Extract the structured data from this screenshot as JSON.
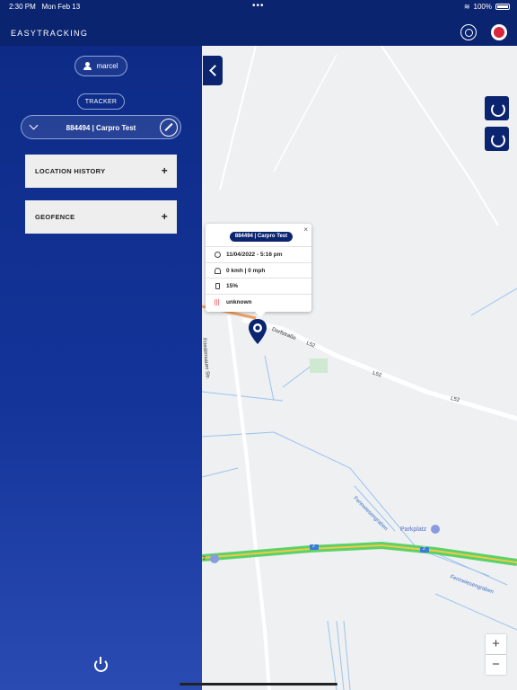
{
  "status_bar": {
    "time": "2:30 PM",
    "date": "Mon Feb 13",
    "dots": "•••",
    "wifi_icon": "wifi-icon",
    "battery_pct": "100%"
  },
  "header": {
    "brand": "EASYTRACKING",
    "icons": [
      "target-icon",
      "alert-pin-icon"
    ]
  },
  "sidebar": {
    "user": "marcel",
    "tracker_label": "TRACKER",
    "tracker_selected": "884494 | Carpro Test",
    "menu": [
      {
        "label": "LOCATION HISTORY",
        "action": "+"
      },
      {
        "label": "GEOFENCE",
        "action": "+"
      }
    ]
  },
  "popup": {
    "title": "884494 | Carpro Test",
    "close": "×",
    "datetime": "11/04/2022 - 5:16 pm",
    "speed": "0 kmh | 0 mph",
    "battery": "15%",
    "signal": "unknown"
  },
  "map": {
    "labels": {
      "dorfstrasse": "Dorfstraße",
      "l52_a": "L52",
      "l52_b": "L52",
      "l52_c": "L52",
      "friedensauer": "Friedensauer Str.",
      "fennwiesengraben_1": "Fennwiesengraben",
      "fennwiesengraben_2": "Fennwiesengraben",
      "parkplatz": "Parkplatz",
      "route_2a": "2",
      "route_2b": "2",
      "route_2c": "2"
    },
    "zoom_in": "+",
    "zoom_out": "−",
    "colors": {
      "water": "#9cc3ee",
      "road": "#ffffff",
      "highway_green": "#5ad26a",
      "highway_yellow": "#f3c847",
      "accent": "#0b2470"
    }
  }
}
